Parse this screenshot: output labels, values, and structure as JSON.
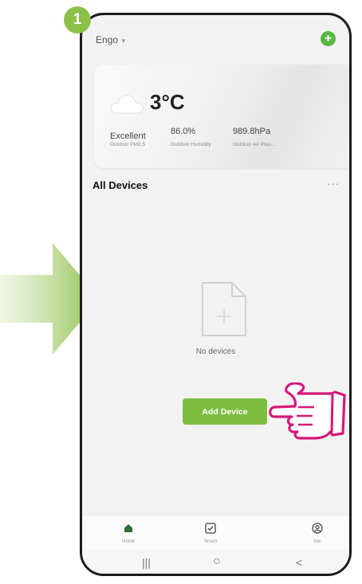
{
  "step": "1",
  "home": {
    "name": "Engo",
    "add_icon": "plus-circle-icon"
  },
  "weather": {
    "temperature": "3°C",
    "icon": "cloud-icon",
    "stats": [
      {
        "value": "Excellent",
        "label": "Outdoor PM2.5"
      },
      {
        "value": "86.0%",
        "label": "Outdoor Humidity"
      },
      {
        "value": "989.8hPa",
        "label": "Outdoor Air Pres..."
      }
    ]
  },
  "devices": {
    "title": "All Devices",
    "more": "···",
    "empty_text": "No devices",
    "add_button": "Add Device"
  },
  "tabs": [
    {
      "label": "Home",
      "icon": "home-icon",
      "active": true
    },
    {
      "label": "Smart",
      "icon": "smart-checkbox-icon",
      "active": false
    },
    {
      "label": "Me",
      "icon": "profile-icon",
      "active": false
    }
  ],
  "system_nav": {
    "recents": "|||",
    "home": "○",
    "back": "<"
  },
  "colors": {
    "accent_green": "#7cbd3f",
    "badge_green": "#8cc04a",
    "hand_magenta": "#d6187a"
  }
}
